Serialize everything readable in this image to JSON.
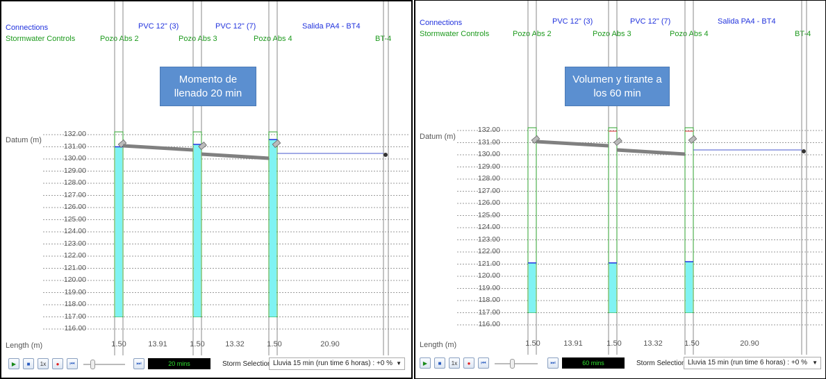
{
  "panels": [
    {
      "header": {
        "row1_left": "Connections",
        "row2_left": "Stormwater Controls",
        "conduits": [
          "PVC 12\" (3)",
          "PVC 12\" (7)",
          "Salida PA4 - BT4"
        ],
        "nodes": [
          "Pozo Abs 2",
          "Pozo Abs 3",
          "Pozo Abs 4",
          "BT-4"
        ]
      },
      "callout": "Momento de llenado 20 min",
      "datum_label": "Datum (m)",
      "length_label": "Length (m)",
      "y_ticks": [
        "132.00",
        "131.00",
        "130.00",
        "129.00",
        "128.00",
        "127.00",
        "126.00",
        "125.00",
        "124.00",
        "123.00",
        "122.00",
        "121.00",
        "120.00",
        "119.00",
        "118.00",
        "117.00",
        "116.00"
      ],
      "lengths": [
        "1.50",
        "13.91",
        "1.50",
        "13.32",
        "1.50",
        "20.90"
      ],
      "water_level_m": [
        131.0,
        131.2,
        131.6
      ],
      "storage_bottom_m": 117.0,
      "toolbar": {
        "time": "20 mins",
        "storm_label": "Storm Selection:",
        "storm_value": "Lluvia 15 min (run time 6 horas) : +0 %",
        "speed_label": "1x"
      }
    },
    {
      "header": {
        "row1_left": "Connections",
        "row2_left": "Stormwater Controls",
        "conduits": [
          "PVC 12\" (3)",
          "PVC 12\" (7)",
          "Salida PA4 - BT4"
        ],
        "nodes": [
          "Pozo Abs 2",
          "Pozo Abs 3",
          "Pozo Abs 4",
          "BT-4"
        ]
      },
      "callout": "Volumen y tirante a los 60 min",
      "datum_label": "Datum (m)",
      "length_label": "Length (m)",
      "y_ticks": [
        "132.00",
        "131.00",
        "130.00",
        "129.00",
        "128.00",
        "127.00",
        "126.00",
        "125.00",
        "124.00",
        "123.00",
        "122.00",
        "121.00",
        "120.00",
        "119.00",
        "118.00",
        "117.00",
        "116.00"
      ],
      "lengths": [
        "1.50",
        "13.91",
        "1.50",
        "13.32",
        "1.50",
        "20.90"
      ],
      "water_level_m": [
        121.1,
        121.1,
        121.2
      ],
      "storage_bottom_m": 117.0,
      "toolbar": {
        "time": "60 mins",
        "storm_label": "Storm Selection:",
        "storm_value": "Lluvia 15 min (run time 6 horas) : +0 %",
        "speed_label": "1x"
      }
    }
  ],
  "colors": {
    "water": "#7ff3f3",
    "pipe": "#808080",
    "datum_line": "#999999",
    "node_outline_green": "#2ca02c",
    "connection_blue": "#2233dd"
  }
}
